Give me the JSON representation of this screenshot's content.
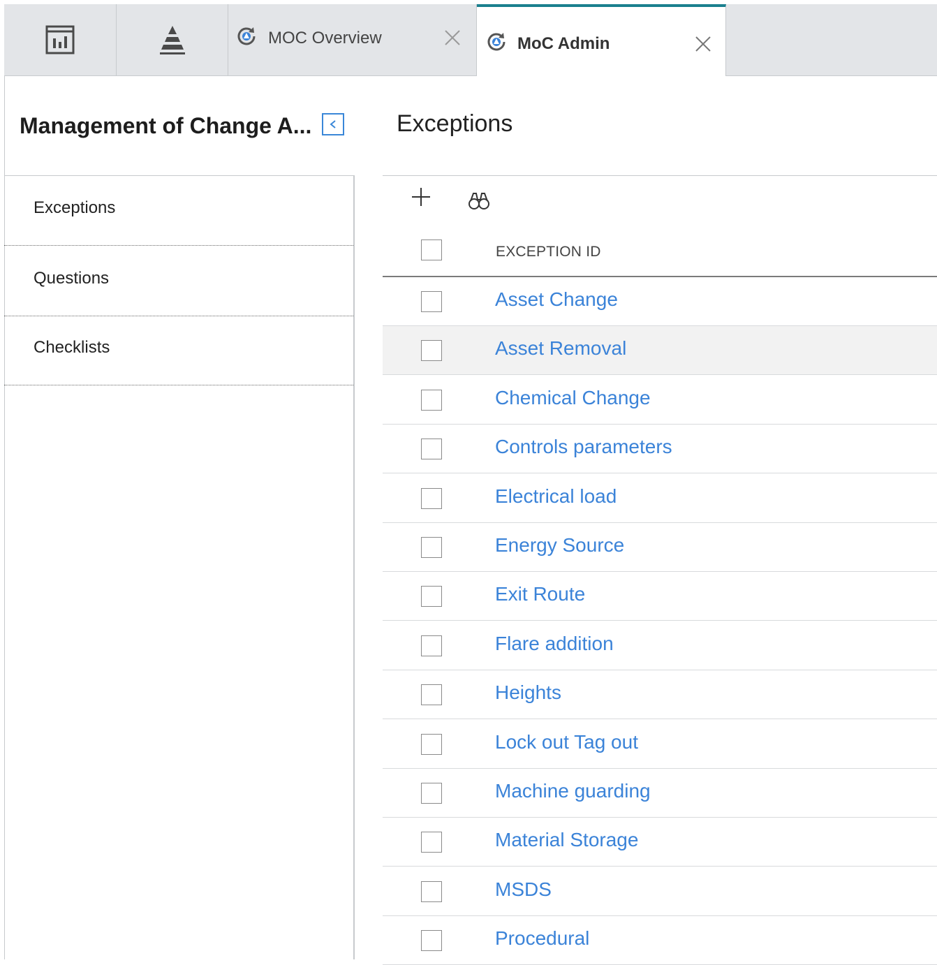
{
  "tabs": {
    "dashboard_icon": "dashboard-chart-icon",
    "pyramid_icon": "pyramid-icon",
    "moc_overview": {
      "label": "MOC Overview",
      "icon": "moc-refresh-icon"
    },
    "moc_admin": {
      "label": "MoC Admin",
      "icon": "moc-refresh-icon",
      "active": true
    },
    "accent_color": "#1a7f8e"
  },
  "left_panel": {
    "title": "Management of Change A...",
    "items": [
      {
        "label": "Exceptions"
      },
      {
        "label": "Questions"
      },
      {
        "label": "Checklists"
      }
    ]
  },
  "main": {
    "title": "Exceptions",
    "toolbar": {
      "add_icon": "plus-icon",
      "search_icon": "binoculars-icon"
    },
    "table": {
      "column_header": "EXCEPTION ID",
      "link_color": "#3b83d8",
      "rows": [
        {
          "label": "Asset Change"
        },
        {
          "label": "Asset Removal"
        },
        {
          "label": "Chemical Change"
        },
        {
          "label": "Controls parameters"
        },
        {
          "label": "Electrical load"
        },
        {
          "label": "Energy Source"
        },
        {
          "label": "Exit Route"
        },
        {
          "label": "Flare addition"
        },
        {
          "label": "Heights"
        },
        {
          "label": "Lock out Tag out"
        },
        {
          "label": "Machine guarding"
        },
        {
          "label": "Material Storage"
        },
        {
          "label": "MSDS"
        },
        {
          "label": "Procedural"
        }
      ]
    }
  }
}
